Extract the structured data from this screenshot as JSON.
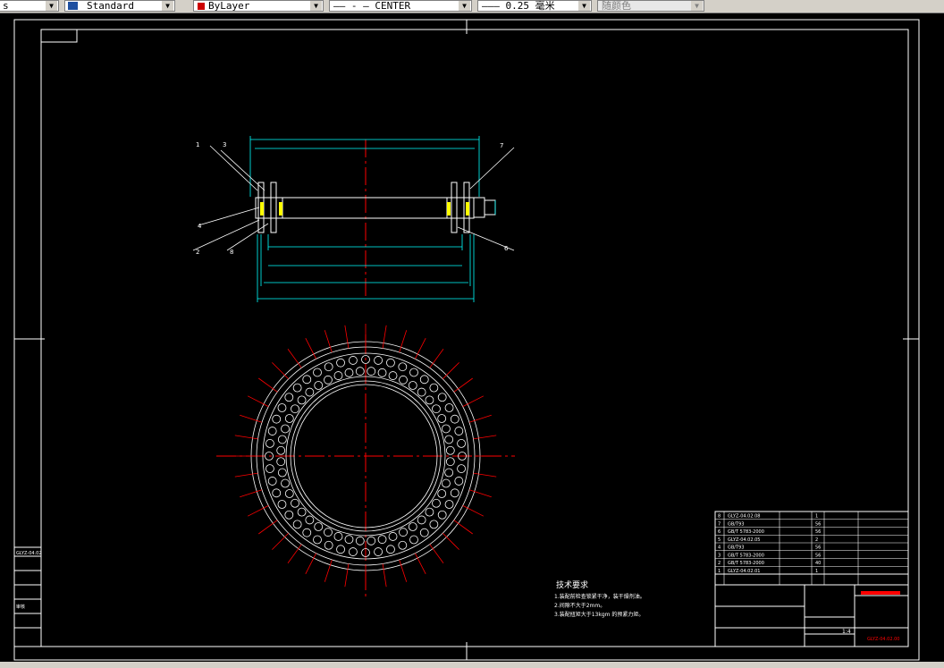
{
  "toolbar": {
    "textstyle_prefix": "s",
    "dimstyle_value": "Standard",
    "color_value": "ByLayer",
    "linetype_value": "—— - —  CENTER",
    "lineweight_value": "——— 0.25 毫米",
    "plotstyle_value": "随颜色",
    "colors": {
      "layer_swatch": "#cc0000"
    }
  },
  "drawing": {
    "background": "#000000",
    "frame_color": "#ffffff",
    "dim_color": "#00ffff",
    "center_color": "#ff0000",
    "part_color": "#ffff00",
    "leader_labels": [
      "1",
      "3",
      "4",
      "2",
      "8",
      "7",
      "6"
    ],
    "tech_req": {
      "title": "技术要求",
      "items": [
        "1.装配前检查锁紧干净，装干燥剂油。",
        "2.间隙不大于2mm。",
        "3.装配扭矩大于13kgm 的预紧力矩。"
      ]
    },
    "bom_rows": [
      {
        "no": "8",
        "code": "GLYZ-04.02.08",
        "qty": "1"
      },
      {
        "no": "7",
        "code": "GB/T93",
        "qty": "56"
      },
      {
        "no": "6",
        "code": "GB/T 5783-2000",
        "qty": "56"
      },
      {
        "no": "5",
        "code": "GLYZ-04.02.05",
        "qty": "2"
      },
      {
        "no": "4",
        "code": "GB/T93",
        "qty": "56"
      },
      {
        "no": "3",
        "code": "GB/T 5783-2000",
        "qty": "56"
      },
      {
        "no": "2",
        "code": "GB/T 5783-2000",
        "qty": "40"
      },
      {
        "no": "1",
        "code": "GLYZ-04.02.01",
        "qty": "1"
      }
    ],
    "scale": "1:4",
    "drawing_no": "GLYZ-04.02.00",
    "left_panel": [
      "GLYZ-04.02",
      "",
      "审核",
      "",
      "",
      ""
    ]
  }
}
